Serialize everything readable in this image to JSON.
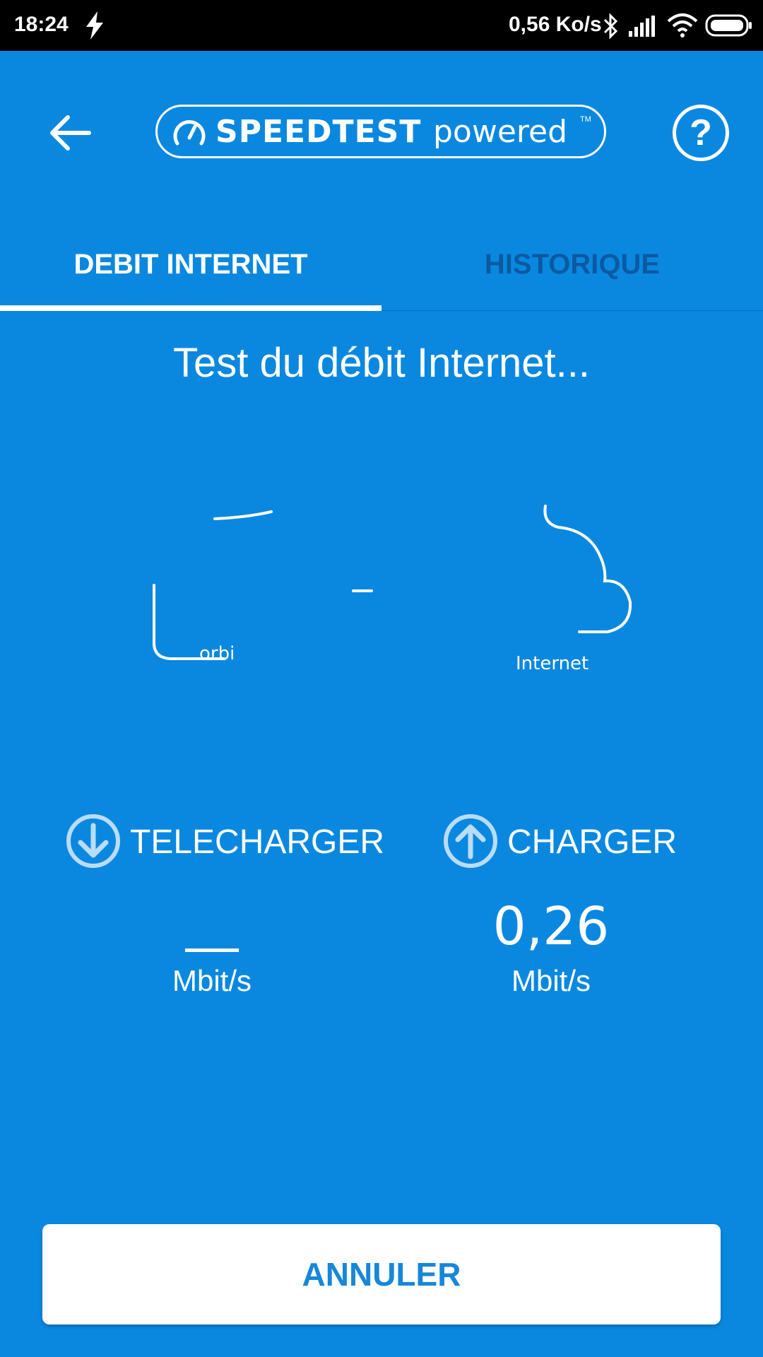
{
  "status_bar": {
    "time": "18:24",
    "network_speed": "0,56 Ko/s",
    "icons": [
      "charging-bolt-icon",
      "bluetooth-icon",
      "signal-icon",
      "wifi-icon",
      "battery-icon"
    ]
  },
  "toolbar": {
    "logo_strong": "SPEEDTEST",
    "logo_light": "powered",
    "logo_tm": "TM"
  },
  "tabs": [
    {
      "label": "DEBIT INTERNET",
      "active": true
    },
    {
      "label": "HISTORIQUE",
      "active": false
    }
  ],
  "heading": "Test du débit Internet...",
  "diagram": {
    "router_label": "orbi",
    "cloud_label": "Internet"
  },
  "metrics": {
    "download": {
      "title": "TELECHARGER",
      "value": "",
      "unit": "Mbit/s"
    },
    "upload": {
      "title": "CHARGER",
      "value": "0,26",
      "unit": "Mbit/s"
    }
  },
  "cancel_label": "ANNULER",
  "colors": {
    "background": "#0a88e0",
    "inactive_tab": "#0a5aa2",
    "button_text": "#1687d9"
  }
}
